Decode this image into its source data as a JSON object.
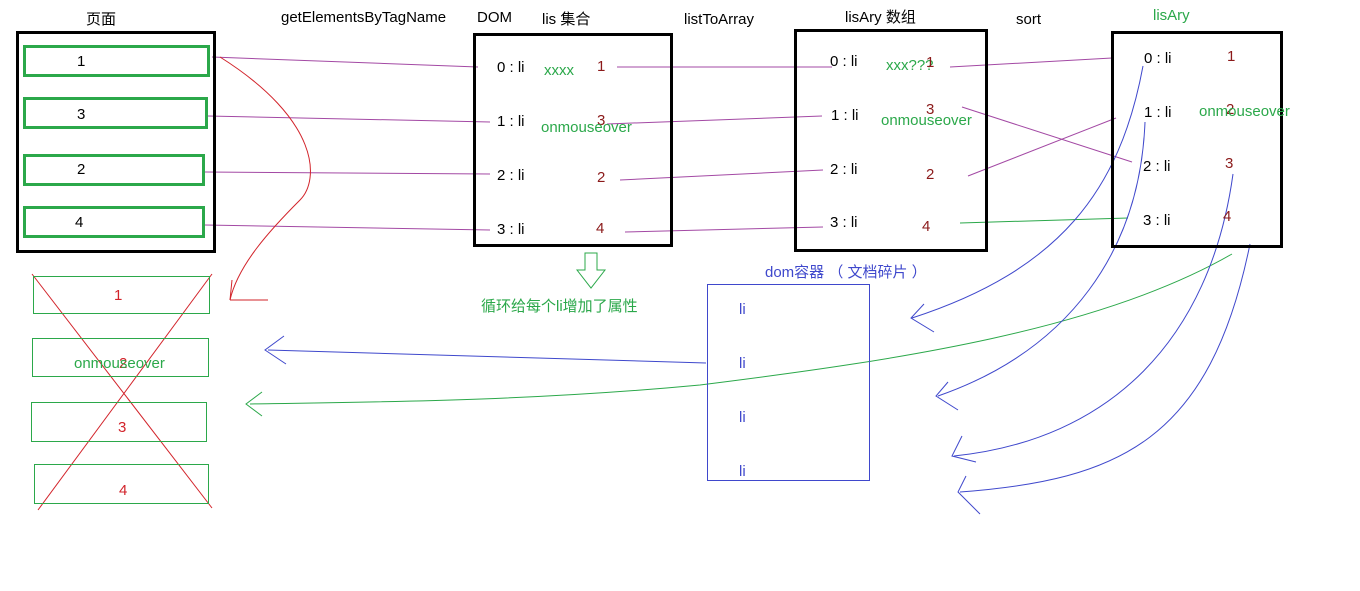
{
  "headers": {
    "page": "页面",
    "get_elements": "getElementsByTagName",
    "dom": "DOM",
    "lis_set": "lis   集合",
    "list_to_array": "listToArray",
    "lisary_array": "lisAry  数组",
    "sort": "sort",
    "lisary": "lisAry"
  },
  "page_items": [
    "1",
    "3",
    "2",
    "4"
  ],
  "lis_indices": [
    "0 :   li",
    "1 :  li",
    "2 :  li",
    "3 :  li"
  ],
  "lis_values": [
    "1",
    "3",
    "2",
    "4"
  ],
  "lis_note_xxxx": "xxxx",
  "lis_note_onmouseover": "onmouseover",
  "lisary_indices": [
    "0  :  li",
    "1 :   li",
    "2  :  li",
    "3  :  li"
  ],
  "lisary_values": [
    "1",
    "3",
    "2",
    "4"
  ],
  "lisary_note_xxx": "xxx???",
  "lisary_note_onmouseover": "onmouseover",
  "sorted_indices": [
    "0 : li",
    "1 : li",
    "2 :  li",
    "3  : li"
  ],
  "sorted_values": [
    "1",
    "2",
    "3",
    "4"
  ],
  "sorted_note_onmouseover": "onmouseover",
  "loop_caption": "循环给每个li增加了属性",
  "fragment_title": "dom容器 （ 文档碎片 ）",
  "fragment_items": [
    "li",
    "li",
    "li",
    "li"
  ],
  "crossed_items": [
    "1",
    "2",
    "3",
    "4"
  ],
  "crossed_note": "onmouseover",
  "colors": {
    "green": "#2ba84a",
    "red": "#d2232a",
    "dark_red": "#8b1a1a",
    "blue": "#3f48cc",
    "purple": "#a349a4",
    "black": "#000000"
  }
}
